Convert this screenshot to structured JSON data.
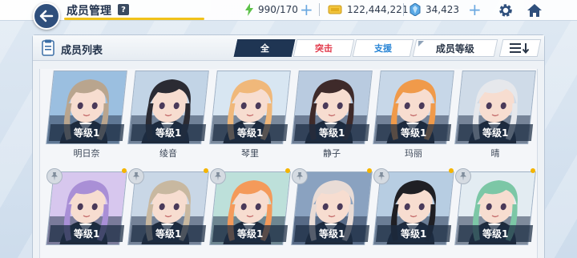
{
  "header": {
    "title": "成员管理",
    "help_label": "?"
  },
  "resources": {
    "ap": "990/170",
    "credits": "122,444,221",
    "gems": "34,423"
  },
  "panel": {
    "title": "成员列表",
    "tabs": [
      {
        "label": "全",
        "state": "active"
      },
      {
        "label": "突击",
        "state": "red"
      },
      {
        "label": "支援",
        "state": "blue"
      }
    ],
    "sort_label": "成员等级"
  },
  "characters": [
    {
      "name": "明日奈",
      "level": "等级1",
      "hair": "#b9a58e",
      "bg": "#9bbfe0"
    },
    {
      "name": "绫音",
      "level": "等级1",
      "hair": "#2b2b33",
      "bg": "#c2d4e6"
    },
    {
      "name": "琴里",
      "level": "等级1",
      "hair": "#f0b87a",
      "bg": "#d8e6f2"
    },
    {
      "name": "静子",
      "level": "等级1",
      "hair": "#3e2a2a",
      "bg": "#b9cbe0"
    },
    {
      "name": "玛丽",
      "level": "等级1",
      "hair": "#f09a4a",
      "bg": "#c7d7e8"
    },
    {
      "name": "晴",
      "level": "等级1",
      "hair": "#e6e8ec",
      "bg": "#cfdbe8"
    }
  ],
  "characters_row2": [
    {
      "level": "等级1",
      "hair": "#a98fd6",
      "bg": "#d7c7ee"
    },
    {
      "level": "等级1",
      "hair": "#c8b8a0",
      "bg": "#c9d7e6"
    },
    {
      "level": "等级1",
      "hair": "#f49a5a",
      "bg": "#bde0da"
    },
    {
      "level": "等级1",
      "hair": "#e9dcd6",
      "bg": "#8aa2c0"
    },
    {
      "level": "等级1",
      "hair": "#1f1f24",
      "bg": "#b7cde2"
    },
    {
      "level": "等级1",
      "hair": "#7cc7a6",
      "bg": "#e3ecf2"
    }
  ],
  "colors": {
    "accent_yellow": "#f1c21a",
    "dark_navy": "#1f3553",
    "red": "#e2384a",
    "blue": "#2a86d6"
  }
}
